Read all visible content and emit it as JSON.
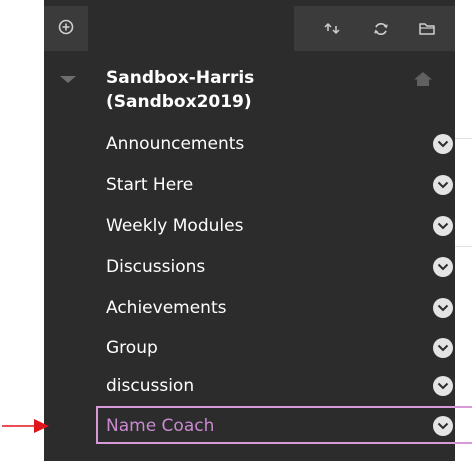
{
  "course": {
    "title_line1": "Sandbox-Harris",
    "title_line2": "(Sandbox2019)"
  },
  "menu": {
    "items": [
      {
        "label": "Announcements"
      },
      {
        "label": "Start Here"
      },
      {
        "label": "Weekly Modules"
      },
      {
        "label": "Discussions"
      },
      {
        "label": "Achievements"
      },
      {
        "label": "Group"
      },
      {
        "label": "discussion"
      },
      {
        "label": "Name Coach"
      }
    ],
    "highlighted_item": "Name Coach"
  },
  "colors": {
    "panel_bg": "#2c2c2c",
    "toolbar_bg": "#3b3b3b",
    "text": "#ffffff",
    "highlight_border": "#d79ad6",
    "highlight_text": "#c98ad0",
    "pointer_arrow": "#e0161d"
  },
  "icons": {
    "toolbar_left": "add-circle-icon",
    "toolbar_right": [
      "reorder-icon",
      "refresh-icon",
      "folder-icon"
    ],
    "course": "home-icon",
    "menu_item": "chevron-down-icon",
    "annotation": "red-arrow-icon"
  }
}
